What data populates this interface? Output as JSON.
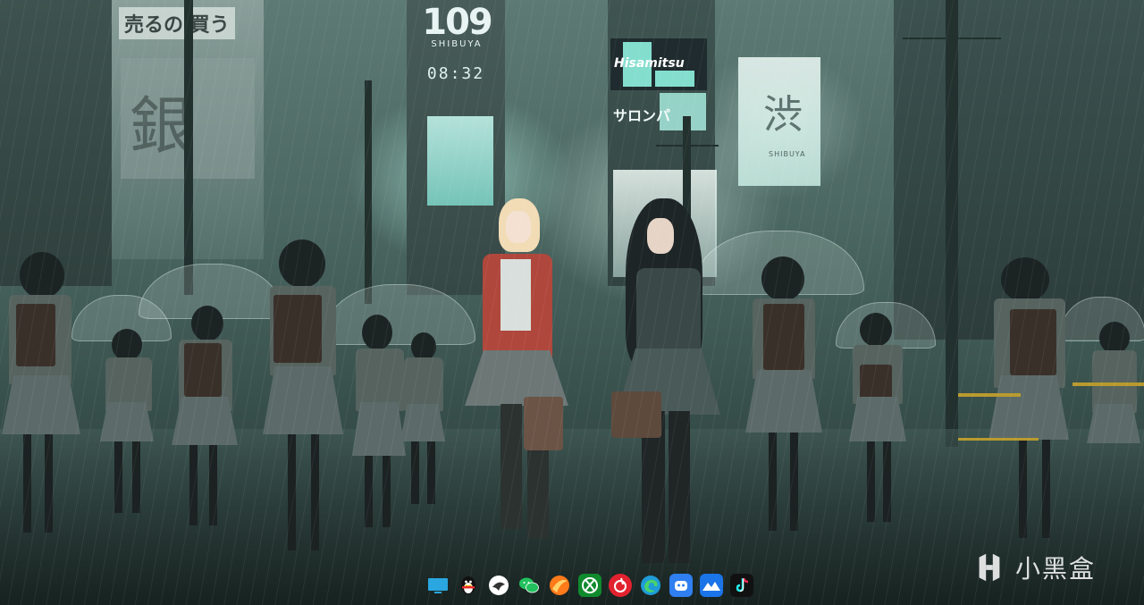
{
  "desktop": {
    "wallpaper_description_colors": {
      "sky": "#5d7a74",
      "ground": "#263835",
      "neon": "#8ef2e0"
    },
    "signs": {
      "sign_109": "109",
      "sign_109_sub": "SHIBUYA",
      "clock": "08:32",
      "hisamitsu": "Hisamitsu",
      "salon": "サロンパ",
      "shibuya_kanji": "渋",
      "shibuya_sub": "SHIBUYA",
      "jp_top": "売るの 買う",
      "jp_big": "銀"
    }
  },
  "taskbar": {
    "apps": [
      {
        "icon": "desktop-icon",
        "label": "Show desktop",
        "color": "#2aa7e0"
      },
      {
        "icon": "qq-penguin-icon",
        "label": "QQ",
        "color": "#111111"
      },
      {
        "icon": "bird-icon",
        "label": "App",
        "color": "#ffffff"
      },
      {
        "icon": "wechat-icon",
        "label": "WeChat",
        "color": "#22c15e"
      },
      {
        "icon": "orange-swirl-icon",
        "label": "App",
        "color": "#ff7a1a"
      },
      {
        "icon": "xbox-icon",
        "label": "Xbox",
        "color": "#0f8a2d"
      },
      {
        "icon": "netease-music-icon",
        "label": "NetEase Cloud Music",
        "color": "#e2222f"
      },
      {
        "icon": "edge-icon",
        "label": "Microsoft Edge",
        "color": "#1f9cd8"
      },
      {
        "icon": "robot-icon",
        "label": "App",
        "color": "#2f7ff0"
      },
      {
        "icon": "mountain-icon",
        "label": "App",
        "color": "#1b74e8"
      },
      {
        "icon": "tiktok-icon",
        "label": "TikTok",
        "color": "#111111"
      }
    ]
  },
  "watermark": {
    "text": "小黑盒"
  }
}
